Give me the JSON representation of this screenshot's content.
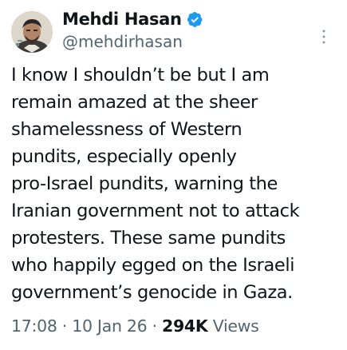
{
  "author": {
    "display_name": "Mehdi Hasan",
    "handle": "@mehdirhasan",
    "verified": true
  },
  "tweet": {
    "lines": [
      "I know I shouldn’t be but I am",
      "remain amazed at the sheer",
      "shamelessness of Western",
      "pundits, especially openly",
      "pro-Israel pundits, warning the",
      "Iranian government not to attack",
      "protesters. These same pundits",
      "who happily egged on the Israeli",
      "government’s genocide in Gaza."
    ]
  },
  "meta": {
    "time": "17:08",
    "separator": "·",
    "date": "10 Jan 26",
    "views_count": "294K",
    "views_label": "Views"
  },
  "icons": {
    "verified": "verified-badge-icon",
    "more": "more-options-icon"
  },
  "colors": {
    "text_primary": "#0f1419",
    "text_secondary": "#536471",
    "verified_blue": "#1d9bf0"
  }
}
